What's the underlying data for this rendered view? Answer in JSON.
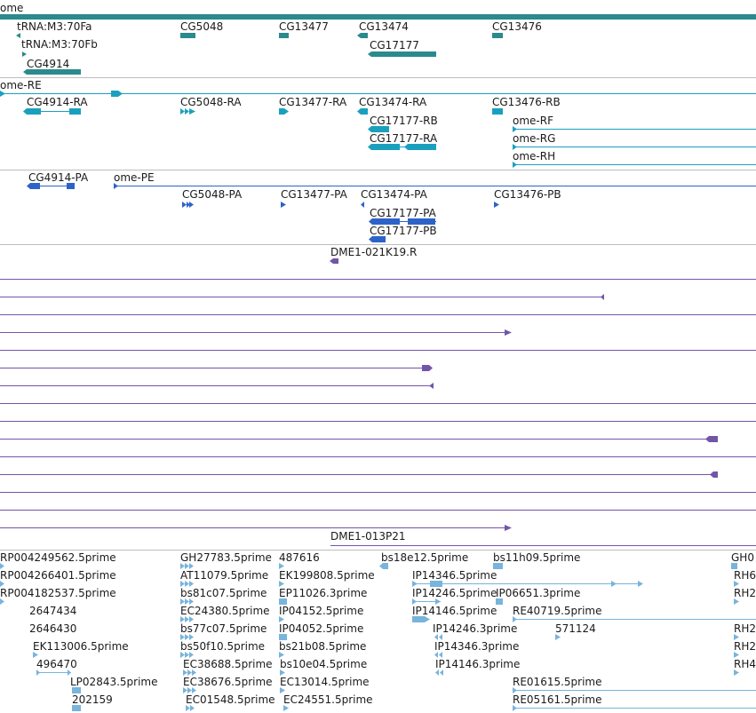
{
  "colors": {
    "gene": "#2b8a8d",
    "rna": "#1aa0be",
    "protein": "#2d63c8",
    "clone": "#7355a8",
    "est": "#78b4dc",
    "separator": "#bdbdbd"
  },
  "tracks": {
    "genes": [
      "ome",
      "tRNA:M3:70Fa",
      "tRNA:M3:70Fb",
      "CG4914",
      "CG5048",
      "CG13477",
      "CG13474",
      "CG17177",
      "CG13476"
    ],
    "transcripts": [
      "ome-RE",
      "CG4914-RA",
      "CG5048-RA",
      "CG13477-RA",
      "CG13474-RA",
      "CG13476-RB",
      "CG17177-RB",
      "CG17177-RA",
      "ome-RF",
      "ome-RG",
      "ome-RH"
    ],
    "proteins": [
      "CG4914-PA",
      "ome-PE",
      "CG5048-PA",
      "CG13477-PA",
      "CG13474-PA",
      "CG13476-PB",
      "CG17177-PA",
      "CG17177-PB"
    ],
    "clones": [
      "DME1-021K19.R",
      "DME1-013P21"
    ],
    "ests": [
      "RP004249562.5prime",
      "GH27783.5prime",
      "487616",
      "bs18e12.5prime",
      "bs11h09.5prime",
      "GH0",
      "RP004266401.5prime",
      "AT11079.5prime",
      "EK199808.5prime",
      "IP14346.5prime",
      "RH6",
      "RP004182537.5prime",
      "bs81c07.5prime",
      "EP11026.3prime",
      "IP14246.5prime",
      "IP06651.3prime",
      "RH2",
      "2647434",
      "EC24380.5prime",
      "IP04152.5prime",
      "IP14146.5prime",
      "RE40719.5prime",
      "2646430",
      "bs77c07.5prime",
      "IP04052.5prime",
      "IP14246.3prime",
      "571124",
      "RH2",
      "EK113006.5prime",
      "bs50f10.5prime",
      "bs21b08.5prime",
      "IP14346.3prime",
      "RH2",
      "496470",
      "EC38688.5prime",
      "bs10e04.5prime",
      "IP14146.3prime",
      "RH4",
      "LP02843.5prime",
      "EC38676.5prime",
      "EC13014.5prime",
      "RE01615.5prime",
      "202159",
      "EC01548.5prime",
      "EC24551.5prime",
      "RE05161.5prime"
    ]
  }
}
